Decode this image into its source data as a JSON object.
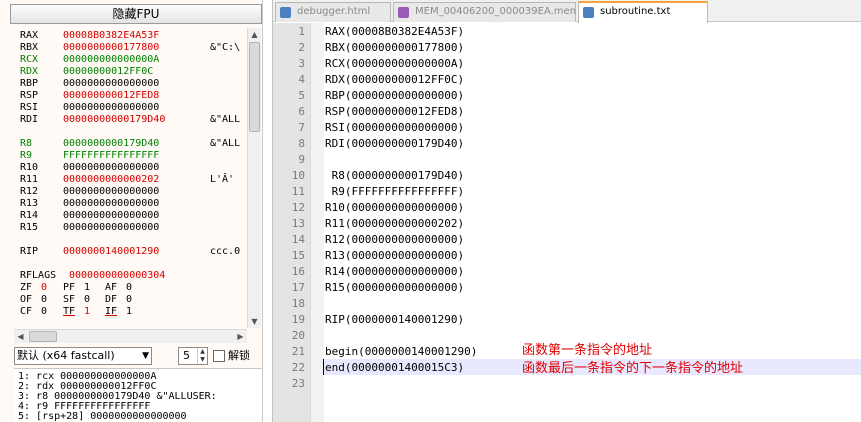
{
  "left_pane": {
    "fpu_button": "隐藏FPU",
    "registers": [
      {
        "name": "RAX",
        "value": "00008B0382E4A53F",
        "comment": "",
        "color": "red"
      },
      {
        "name": "RBX",
        "value": "0000000000177800",
        "comment": "&\"C:\\",
        "color": "red"
      },
      {
        "name": "RCX",
        "value": "000000000000000A",
        "comment": "",
        "color": "green"
      },
      {
        "name": "RDX",
        "value": "00000000012FF0C",
        "comment": "",
        "color": "green"
      },
      {
        "name": "RBP",
        "value": "0000000000000000",
        "comment": "",
        "color": "black"
      },
      {
        "name": "RSP",
        "value": "000000000012FED8",
        "comment": "",
        "color": "red"
      },
      {
        "name": "RSI",
        "value": "0000000000000000",
        "comment": "",
        "color": "black"
      },
      {
        "name": "RDI",
        "value": "00000000000179D40",
        "comment": "&\"ALL",
        "color": "red"
      },
      {
        "name": "R8",
        "value": "0000000000179D40",
        "comment": "&\"ALL",
        "color": "green"
      },
      {
        "name": "R9",
        "value": "FFFFFFFFFFFFFFFF",
        "comment": "",
        "color": "green"
      },
      {
        "name": "R10",
        "value": "0000000000000000",
        "comment": "",
        "color": "black"
      },
      {
        "name": "R11",
        "value": "0000000000000202",
        "comment": "L'Â'",
        "color": "red"
      },
      {
        "name": "R12",
        "value": "0000000000000000",
        "comment": "",
        "color": "black"
      },
      {
        "name": "R13",
        "value": "0000000000000000",
        "comment": "",
        "color": "black"
      },
      {
        "name": "R14",
        "value": "0000000000000000",
        "comment": "",
        "color": "black"
      },
      {
        "name": "R15",
        "value": "0000000000000000",
        "comment": "",
        "color": "black"
      },
      {
        "name": "RIP",
        "value": "0000000140001290",
        "comment": "ccc.0",
        "color": "red"
      }
    ],
    "rflags": {
      "name": "RFLAGS",
      "value": "0000000000000304"
    },
    "flag_rows": [
      [
        {
          "name": "ZF",
          "val": "0",
          "red": true
        },
        {
          "name": "PF",
          "val": "1",
          "red": false
        },
        {
          "name": "AF",
          "val": "0",
          "red": false
        }
      ],
      [
        {
          "name": "OF",
          "val": "0",
          "red": false
        },
        {
          "name": "SF",
          "val": "0",
          "red": false
        },
        {
          "name": "DF",
          "val": "0",
          "red": false
        }
      ],
      [
        {
          "name": "CF",
          "val": "0",
          "red": false
        },
        {
          "name": "TF",
          "val": "1",
          "red": true
        },
        {
          "name": "IF",
          "val": "1",
          "red": false
        }
      ]
    ],
    "calling_convention": "默认 (x64 fastcall)",
    "arg_count": "5",
    "lock_label": "解锁",
    "arguments": [
      "1: rcx 000000000000000A",
      "2: rdx 000000000012FF0C",
      "3: r8 0000000000179D40 &\"ALLUSER:",
      "4: r9 FFFFFFFFFFFFFFFF",
      "5: [rsp+28] 0000000000000000"
    ]
  },
  "editor": {
    "tabs": [
      {
        "label": "debugger.html",
        "active": false,
        "icon_color": "#4a7fc1"
      },
      {
        "label": "MEM_00406200_000039EA.mem",
        "active": false,
        "icon_color": "#9b59b6"
      },
      {
        "label": "subroutine.txt",
        "active": true,
        "icon_color": "#4a7fc1"
      }
    ],
    "lines": [
      "RAX(00008B0382E4A53F)",
      "RBX(0000000000177800)",
      "RCX(000000000000000A)",
      "RDX(000000000012FF0C)",
      "RBP(0000000000000000)",
      "RSP(000000000012FED8)",
      "RSI(0000000000000000)",
      "RDI(0000000000179D40)",
      "",
      " R8(0000000000179D40)",
      " R9(FFFFFFFFFFFFFFFF)",
      "R10(0000000000000000)",
      "R11(0000000000000202)",
      "R12(0000000000000000)",
      "R13(0000000000000000)",
      "R14(0000000000000000)",
      "R15(0000000000000000)",
      "",
      "RIP(0000000140001290)",
      "",
      "begin(0000000140001290)",
      "end(00000001400015C3)",
      ""
    ],
    "line_numbers": [
      "1",
      "2",
      "3",
      "4",
      "5",
      "6",
      "7",
      "8",
      "9",
      "10",
      "11",
      "12",
      "13",
      "14",
      "15",
      "16",
      "17",
      "18",
      "19",
      "20",
      "21",
      "22",
      "23"
    ],
    "annotations": {
      "begin_note": "函数第一条指令的地址",
      "end_note": "函数最后一条指令的下一条指令的地址"
    }
  }
}
